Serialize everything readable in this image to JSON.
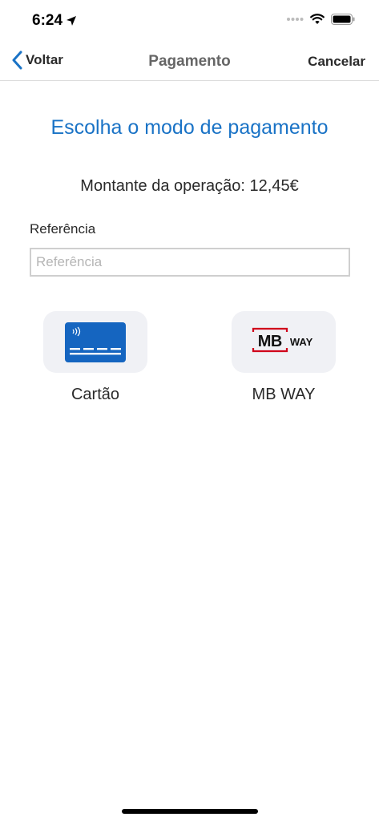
{
  "status_bar": {
    "time": "6:24"
  },
  "nav": {
    "back_label": "Voltar",
    "title": "Pagamento",
    "cancel_label": "Cancelar"
  },
  "main": {
    "heading": "Escolha o modo de pagamento",
    "amount_text": "Montante da operação: 12,45€",
    "reference": {
      "label": "Referência",
      "placeholder": "Referência",
      "value": ""
    },
    "payment_options": [
      {
        "label": "Cartão",
        "icon": "credit-card-icon"
      },
      {
        "label": "MB WAY",
        "icon": "mbway-logo-icon",
        "logo_text_left": "MB",
        "logo_text_right": "WAY"
      }
    ]
  },
  "colors": {
    "accent": "#1a73c6",
    "card_blue": "#1565c0",
    "mbway_red": "#d0021b",
    "tile_bg": "#f0f1f5"
  }
}
